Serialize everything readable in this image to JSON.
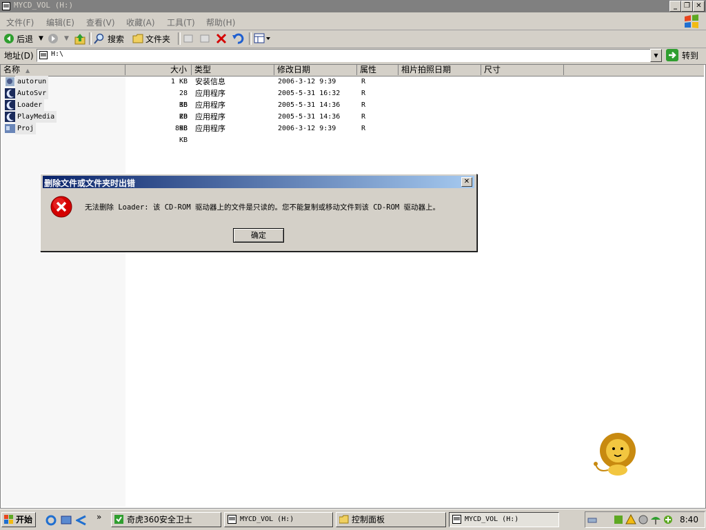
{
  "window": {
    "title": "MYCD_VOL (H:)"
  },
  "menu": [
    "文件(F)",
    "编辑(E)",
    "查看(V)",
    "收藏(A)",
    "工具(T)",
    "帮助(H)"
  ],
  "toolbar": {
    "back": "后退",
    "search": "搜索",
    "folders": "文件夹"
  },
  "address": {
    "label": "地址(D)",
    "value": "H:\\",
    "go": "转到"
  },
  "columns": [
    "名称",
    "大小",
    "类型",
    "修改日期",
    "属性",
    "相片拍照日期",
    "尺寸"
  ],
  "files": [
    {
      "name": "autorun",
      "size": "1 KB",
      "type": "安装信息",
      "modified": "2006-3-12 9:39",
      "attr": "R"
    },
    {
      "name": "AutoSvr",
      "size": "28 KB",
      "type": "应用程序",
      "modified": "2005-5-31 16:32",
      "attr": "R"
    },
    {
      "name": "Loader",
      "size": "36 KB",
      "type": "应用程序",
      "modified": "2005-5-31 14:36",
      "attr": "R"
    },
    {
      "name": "PlayMedia",
      "size": "20 KB",
      "type": "应用程序",
      "modified": "2005-5-31 14:36",
      "attr": "R"
    },
    {
      "name": "Proj",
      "size": "898 KB",
      "type": "应用程序",
      "modified": "2006-3-12 9:39",
      "attr": "R"
    }
  ],
  "dialog": {
    "title": "删除文件或文件夹时出错",
    "message": "无法删除 Loader: 该 CD-ROM 驱动器上的文件是只读的。您不能复制或移动文件到该 CD-ROM 驱动器上。",
    "ok": "确定"
  },
  "taskbar": {
    "start": "开始",
    "tasks": [
      "奇虎360安全卫士",
      "MYCD_VOL (H:)",
      "控制面板",
      "MYCD_VOL (H:)"
    ],
    "clock": "8:40"
  },
  "colors": {
    "titlebar_inactive": "#808080",
    "dialog_title": "#0a246a",
    "error_red": "#d40000"
  }
}
